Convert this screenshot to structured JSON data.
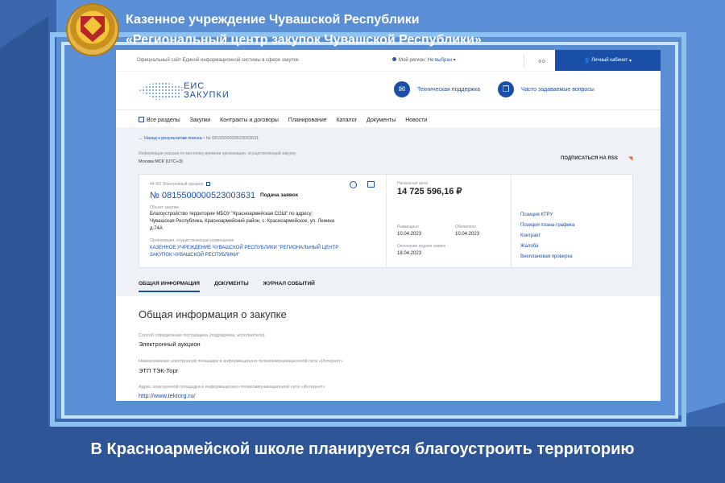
{
  "banner": {
    "title_line1": "Казенное учреждение Чувашской Республики",
    "title_line2": "«Региональный центр закупок Чувашской Республики»"
  },
  "topbar": {
    "official_site": "Официальный сайт Единой информационной системы в сфере закупок",
    "region_label": "Мой регион:",
    "region_value": "Не выбран",
    "cabinet_label": "Личный кабинет"
  },
  "brand": {
    "logo_line1": "ЕИС",
    "logo_line2": "ЗАКУПКИ",
    "support_label": "Техническая поддержка",
    "faq_label": "Часто задаваемые вопросы"
  },
  "nav": {
    "items": [
      "Все разделы",
      "Закупки",
      "Контракты и договоры",
      "Планирование",
      "Каталог",
      "Документы",
      "Новости"
    ]
  },
  "breadcrumbs": {
    "back": "Назад к результатам поиска",
    "current": "№ 0815500000523003631"
  },
  "timezone": {
    "note": "Информация указана по местному времени организации, осуществляющей закупку",
    "value": "Москва МСК (UTC+3)"
  },
  "rss_label": "ПОДПИСАТЬСЯ НА RSS",
  "card": {
    "law": "44-ФЗ Электронный аукцион",
    "number": "№ 0815500000523003631",
    "stage": "Подача заявок",
    "object_label": "Объект закупки",
    "object_line1": "Благоустройство территории МБОУ \"Красноармейская СОШ\" по адресу:",
    "object_line2": "Чувашская Республика, Красноармейский район, с. Красноармейское, ул. Ленина",
    "object_line3": "д.74А",
    "org_label": "Организация, осуществляющая размещение",
    "org_line1": "КАЗЕННОЕ УЧРЕЖДЕНИЕ ЧУВАШСКОЙ РЕСПУБЛИКИ \"РЕГИОНАЛЬНЫЙ ЦЕНТР",
    "org_line2": "ЗАКУПОК ЧУВАШСКОЙ РЕСПУБЛИКИ\"",
    "price_label": "Начальная цена",
    "price": "14 725 596,16 ₽",
    "posted_label": "Размещено",
    "posted": "10.04.2023",
    "updated_label": "Обновлено",
    "updated": "10.04.2023",
    "deadline_label": "Окончание подачи заявок",
    "deadline": "18.04.2023",
    "links": [
      "Позиция КТРУ",
      "Позиция плана-графика",
      "Контракт",
      "Жалоба",
      "Внеплановая проверка"
    ]
  },
  "tabs": [
    "ОБЩАЯ ИНФОРМАЦИЯ",
    "ДОКУМЕНТЫ",
    "ЖУРНАЛ СОБЫТИЙ"
  ],
  "general": {
    "title": "Общая информация о закупке",
    "method_label": "Способ определения поставщика (подрядчика, исполнителя)",
    "method_value": "Электронный аукцион",
    "platform_label": "Наименование электронной площадки в информационно-телекоммуникационной сети «Интернет»",
    "platform_value": "ЭТП ТЭК-Торг",
    "address_label": "Адрес электронной площадки в информационно-телекоммуникационной сети «Интернет»",
    "address_value": "http://www.tektorg.ru/"
  },
  "caption": "В Красноармейской школе планируется благоустроить территорию"
}
